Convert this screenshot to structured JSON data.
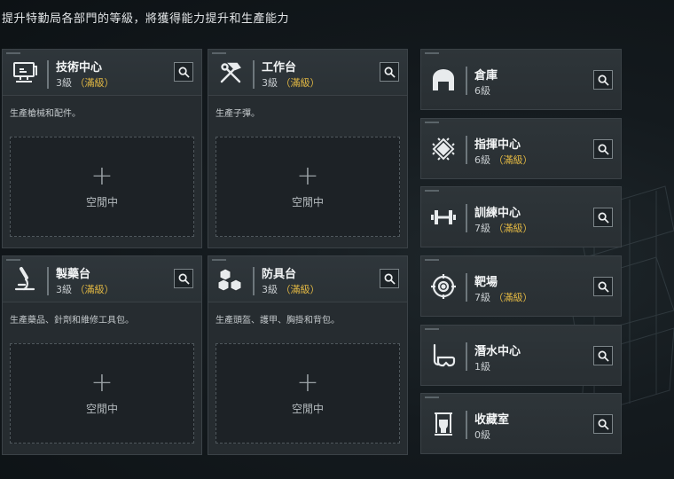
{
  "header": {
    "text": "提升特勤局各部門的等級，將獲得能力提升和生產能力"
  },
  "level_suffix": "級",
  "max_label": "（滿級）",
  "slot_label": "空閒中",
  "slot_plus": "+",
  "production_cards": [
    {
      "title": "技術中心",
      "level": "3級",
      "maxed": "（滿級）",
      "icon": "computer-icon",
      "desc": "生產槍械和配件。"
    },
    {
      "title": "工作台",
      "level": "3級",
      "maxed": "（滿級）",
      "icon": "hammer-wrench-icon",
      "desc": "生產子彈。"
    },
    {
      "title": "製藥台",
      "level": "3級",
      "maxed": "（滿級）",
      "icon": "microscope-icon",
      "desc": "生產藥品、針劑和維修工具包。"
    },
    {
      "title": "防具台",
      "level": "3級",
      "maxed": "（滿級）",
      "icon": "cubes-icon",
      "desc": "生產頭盔、護甲、胸掛和背包。"
    }
  ],
  "side_cards": [
    {
      "title": "倉庫",
      "level": "6級",
      "maxed": "",
      "icon": "warehouse-icon"
    },
    {
      "title": "指揮中心",
      "level": "6級",
      "maxed": "（滿級）",
      "icon": "chip-icon"
    },
    {
      "title": "訓練中心",
      "level": "7級",
      "maxed": "（滿級）",
      "icon": "dumbbell-icon"
    },
    {
      "title": "靶場",
      "level": "7級",
      "maxed": "（滿級）",
      "icon": "target-icon"
    },
    {
      "title": "潛水中心",
      "level": "1級",
      "maxed": "",
      "icon": "diving-mask-icon"
    },
    {
      "title": "收藏室",
      "level": "0級",
      "maxed": "",
      "icon": "trophy-case-icon"
    }
  ],
  "colors": {
    "accent_maxed": "#e2b843",
    "card_bg": "#262c30",
    "page_bg": "#141a1e"
  }
}
